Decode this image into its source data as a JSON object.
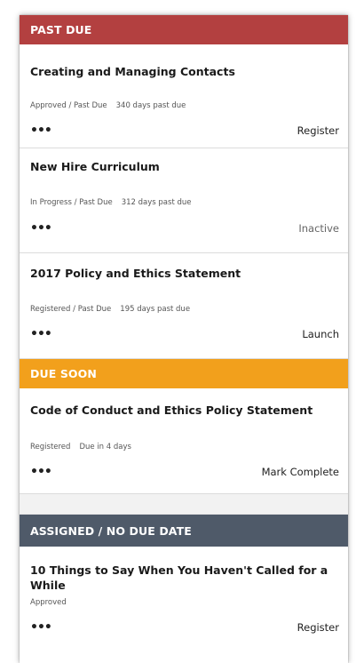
{
  "sections": {
    "past_due": {
      "header": "PAST DUE",
      "items": [
        {
          "title": "Creating and Managing Contacts",
          "status": "Approved / Past Due",
          "due": "340 days past due",
          "action": "Register"
        },
        {
          "title": "New Hire Curriculum",
          "status": "In Progress / Past Due",
          "due": "312 days past due",
          "action": "Inactive"
        },
        {
          "title": "2017 Policy and Ethics Statement",
          "status": "Registered / Past Due",
          "due": "195 days past due",
          "action": "Launch"
        }
      ]
    },
    "due_soon": {
      "header": "DUE SOON",
      "items": [
        {
          "title": "Code of Conduct and Ethics Policy Statement",
          "status": "Registered",
          "due": "Due in 4 days",
          "action": "Mark Complete"
        }
      ]
    },
    "assigned": {
      "header": "ASSIGNED / NO DUE DATE",
      "items": [
        {
          "title": "10 Things to Say When You Haven't Called for a While",
          "status": "Approved",
          "action": "Register"
        }
      ]
    }
  },
  "more_glyph": "•••",
  "colors": {
    "past_due": "#b34040",
    "due_soon": "#f2a01c",
    "assigned": "#4f5a69"
  },
  "icons": {
    "more": "more-dots-icon"
  }
}
